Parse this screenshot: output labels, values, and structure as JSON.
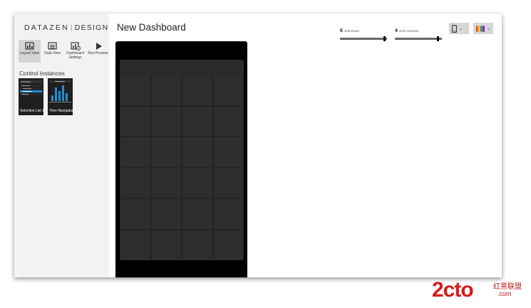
{
  "app": {
    "brand": "DATAZEN",
    "product": "DESIGNER"
  },
  "toolbar": [
    {
      "label": "Layout View",
      "icon": "layout-view-icon",
      "active": true
    },
    {
      "label": "Data View",
      "icon": "data-view-icon",
      "active": false
    },
    {
      "label": "Dashboard Settings",
      "icon": "dashboard-settings-icon",
      "active": false
    },
    {
      "label": "Run Preview",
      "icon": "play-icon",
      "active": false
    }
  ],
  "sidebar": {
    "section_title": "Control Instances",
    "instances": [
      {
        "caption": "Selection List 1",
        "icon": "selection-list-thumbnail"
      },
      {
        "caption": "Time Navigator",
        "icon": "time-navigator-thumbnail"
      }
    ]
  },
  "main": {
    "title": "New Dashboard"
  },
  "grid_settings": {
    "rows_value": "6",
    "rows_label": "Grid Rows",
    "rows_fraction": 0.97,
    "columns_value": "4",
    "columns_label": "Grid Columns",
    "columns_fraction": 0.93
  },
  "pickers": [
    {
      "name": "device-picker",
      "icon": "phone-icon"
    },
    {
      "name": "theme-picker",
      "icon": "color-palette-icon"
    }
  ],
  "canvas": {
    "rows": 6,
    "columns": 4
  },
  "watermark": {
    "main": "2cto",
    "suffix": ".com",
    "sub": "红黑联盟"
  },
  "colors": {
    "sidebar_bg": "#f2f2f2",
    "device_frame": "#000000",
    "grid_cell": "#2e2e2e",
    "watermark": "#d61a1a"
  }
}
